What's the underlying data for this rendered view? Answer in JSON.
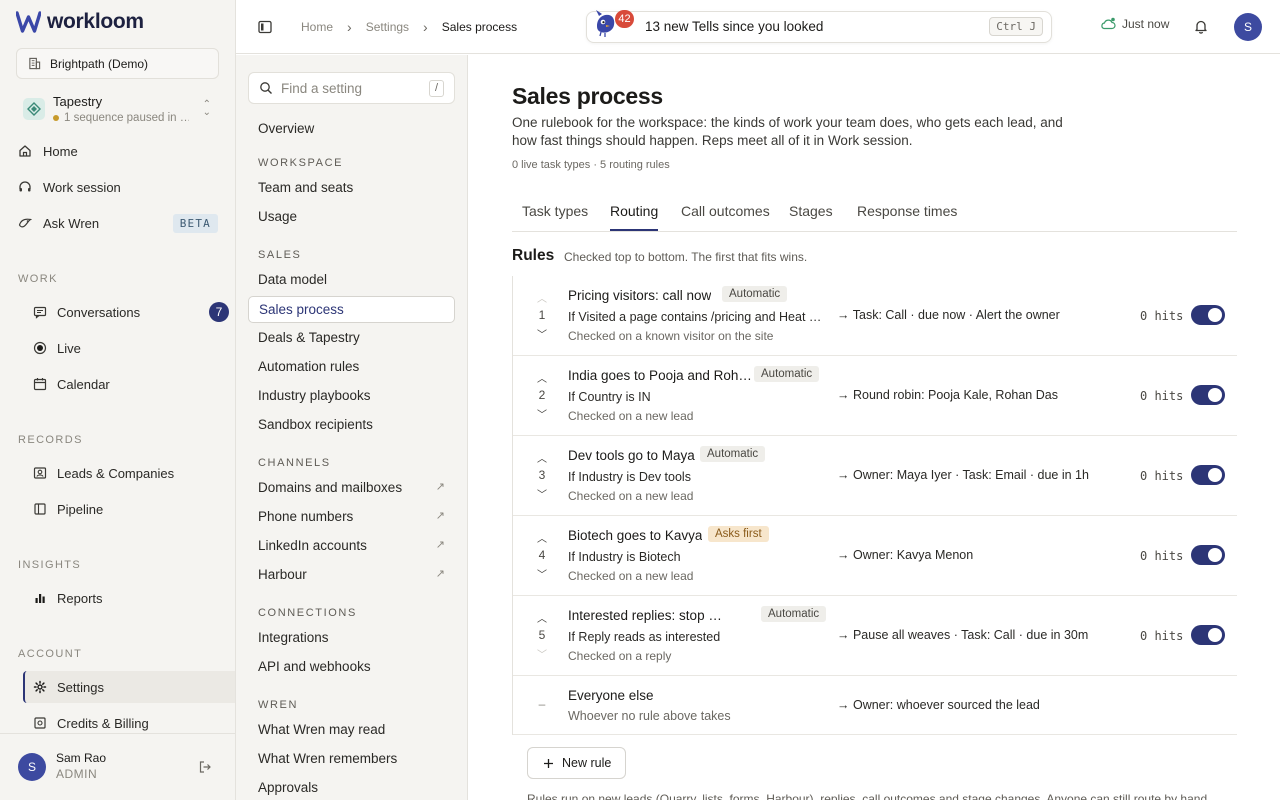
{
  "app": {
    "name": "workloom"
  },
  "sidebar": {
    "workspace": "Brightpath (Demo)",
    "tapestry": {
      "name": "Tapestry",
      "status": "1 sequence paused in …"
    },
    "top_items": [
      {
        "label": "Home"
      },
      {
        "label": "Work session"
      },
      {
        "label": "Ask Wren",
        "badge": "BETA"
      }
    ],
    "sections": [
      {
        "title": "WORK",
        "items": [
          {
            "label": "Conversations",
            "count": "7"
          },
          {
            "label": "Live"
          },
          {
            "label": "Calendar"
          }
        ]
      },
      {
        "title": "RECORDS",
        "items": [
          {
            "label": "Leads & Companies"
          },
          {
            "label": "Pipeline"
          }
        ]
      },
      {
        "title": "INSIGHTS",
        "items": [
          {
            "label": "Reports"
          }
        ]
      },
      {
        "title": "ACCOUNT",
        "items": [
          {
            "label": "Settings",
            "active": true
          },
          {
            "label": "Credits & Billing"
          }
        ]
      }
    ],
    "user": {
      "initial": "S",
      "name": "Sam Rao",
      "role": "ADMIN"
    }
  },
  "topbar": {
    "breadcrumbs": [
      "Home",
      "Settings",
      "Sales process"
    ],
    "tells": {
      "count": "42",
      "text": "13 new Tells since you looked",
      "shortcut": "Ctrl J"
    },
    "sync": "Just now",
    "avatar": "S"
  },
  "settings_nav": {
    "search_placeholder": "Find a setting",
    "search_shortcut": "/",
    "overview": "Overview",
    "sections": [
      {
        "title": "WORKSPACE",
        "items": [
          "Team and seats",
          "Usage"
        ]
      },
      {
        "title": "SALES",
        "items": [
          "Data model",
          "Sales process",
          "Deals & Tapestry",
          "Automation rules",
          "Industry playbooks",
          "Sandbox recipients"
        ]
      },
      {
        "title": "CHANNELS",
        "items": [
          "Domains and mailboxes",
          "Phone numbers",
          "LinkedIn accounts",
          "Harbour"
        ]
      },
      {
        "title": "CONNECTIONS",
        "items": [
          "Integrations",
          "API and webhooks"
        ]
      },
      {
        "title": "WREN",
        "items": [
          "What Wren may read",
          "What Wren remembers",
          "Approvals"
        ]
      }
    ],
    "active": "Sales process"
  },
  "main": {
    "title": "Sales process",
    "description": "One rulebook for the workspace: the kinds of work your team does, who gets each lead, and how fast things should happen. Reps meet all of it in Work session.",
    "meta": "0 live task types · 5 routing rules",
    "tabs": [
      "Task types",
      "Routing",
      "Call outcomes",
      "Stages",
      "Response times"
    ],
    "active_tab": "Routing",
    "rules_title": "Rules",
    "rules_subtitle": "Checked top to bottom. The first that fits wins.",
    "rules": [
      {
        "num": "1",
        "name": "Pricing visitors: call now",
        "mode": "Automatic",
        "condition": "If Visited a page contains /pricing and Heat is …",
        "checked": "Checked on a known visitor on the site",
        "action": "→ Task: Call · due now · Alert the owner",
        "hits": "0 hits",
        "enabled": true
      },
      {
        "num": "2",
        "name": "India goes to Pooja and Rohan",
        "mode": "Automatic",
        "condition": "If Country is IN",
        "checked": "Checked on a new lead",
        "action": "→ Round robin: Pooja Kale, Rohan Das",
        "hits": "0 hits",
        "enabled": true
      },
      {
        "num": "3",
        "name": "Dev tools go to Maya",
        "mode": "Automatic",
        "condition": "If Industry is Dev tools",
        "checked": "Checked on a new lead",
        "action": "→ Owner: Maya Iyer · Task: Email · due in 1h",
        "hits": "0 hits",
        "enabled": true
      },
      {
        "num": "4",
        "name": "Biotech goes to Kavya",
        "mode": "Asks first",
        "condition": "If Industry is Biotech",
        "checked": "Checked on a new lead",
        "action": "→ Owner: Kavya Menon",
        "hits": "0 hits",
        "enabled": true
      },
      {
        "num": "5",
        "name": "Interested replies: stop the w…",
        "mode": "Automatic",
        "condition": "If Reply reads as interested",
        "checked": "Checked on a reply",
        "action": "→ Pause all weaves · Task: Call · due in 30m",
        "hits": "0 hits",
        "enabled": true
      }
    ],
    "fallback": {
      "num": "–",
      "name": "Everyone else",
      "description": "Whoever no rule above takes",
      "action": "→ Owner: whoever sourced the lead"
    },
    "new_rule": "New rule",
    "footnote": "Rules run on new leads (Quarry, lists, forms, Harbour), replies, call outcomes and stage changes. Anyone can still route by hand."
  }
}
